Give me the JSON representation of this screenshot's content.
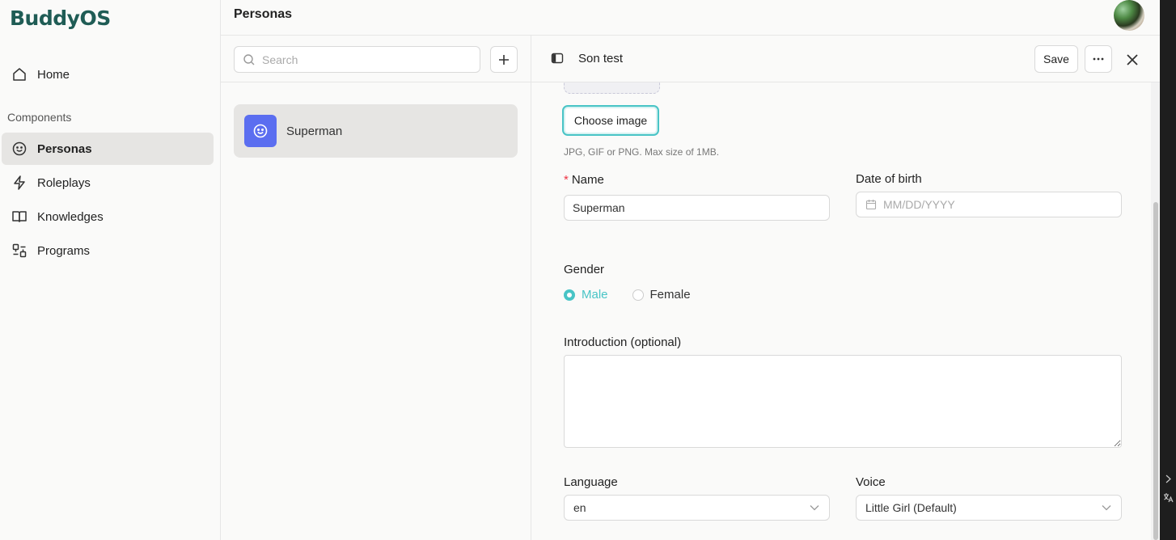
{
  "app": {
    "logo": "BuddyOS"
  },
  "sidebar": {
    "home": "Home",
    "section": "Components",
    "items": [
      {
        "label": "Personas",
        "icon": "smile-icon"
      },
      {
        "label": "Roleplays",
        "icon": "bolt-icon"
      },
      {
        "label": "Knowledges",
        "icon": "book-icon"
      },
      {
        "label": "Programs",
        "icon": "program-icon"
      }
    ]
  },
  "header": {
    "title": "Personas"
  },
  "list": {
    "search_placeholder": "Search",
    "items": [
      {
        "name": "Superman"
      }
    ]
  },
  "detail": {
    "title": "Son test",
    "save_label": "Save",
    "choose_image_label": "Choose image",
    "image_hint": "JPG, GIF or PNG. Max size of 1MB.",
    "name_label": "Name",
    "name_required_marker": "*",
    "name_value": "Superman",
    "dob_label": "Date of birth",
    "dob_placeholder": "MM/DD/YYYY",
    "gender_label": "Gender",
    "gender_options": [
      "Male",
      "Female"
    ],
    "gender_selected": "Male",
    "intro_label": "Introduction (optional)",
    "intro_value": "",
    "language_label": "Language",
    "language_value": "en",
    "voice_label": "Voice",
    "voice_value": "Little Girl (Default)"
  },
  "colors": {
    "brand": "#1f5c55",
    "accent": "#48c4c6",
    "persona_icon_bg": "#5b6ef0",
    "required": "#e34444"
  }
}
